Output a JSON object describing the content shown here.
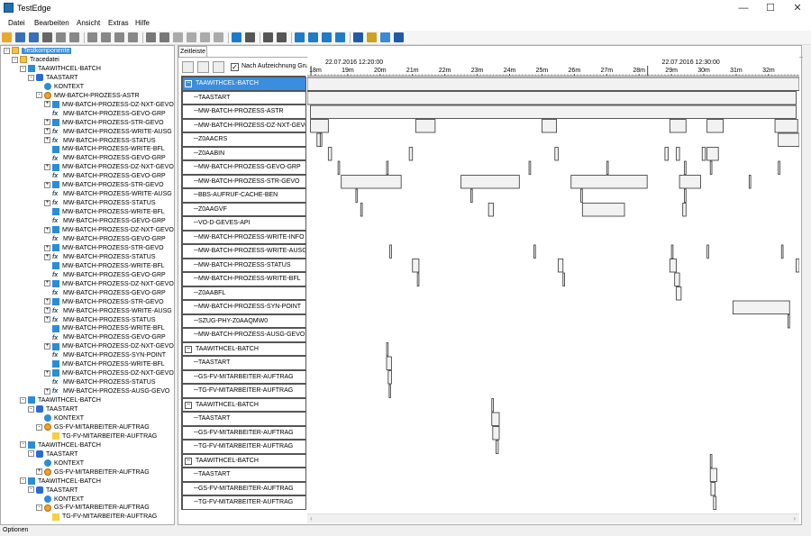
{
  "window": {
    "title": "TestEdge",
    "minimize": "—",
    "maximize": "☐",
    "close": "✕"
  },
  "menu": [
    "Datei",
    "Bearbeiten",
    "Ansicht",
    "Extras",
    "Hilfe"
  ],
  "toolbar_icons": [
    "open-icon",
    "save-icon",
    "save-all-icon",
    "print-icon",
    "copy-icon",
    "import-icon",
    "run-icon",
    "run-all-icon",
    "stop-icon",
    "export-icon",
    "undo-icon",
    "redo-icon",
    "cut-icon",
    "copy2-icon",
    "paste-icon",
    "link-icon",
    "tree-icon",
    "car-icon",
    "back-icon",
    "forward-icon",
    "layout1-icon",
    "layout2-icon",
    "layout3-icon",
    "layout4-icon",
    "help-icon",
    "pin-icon",
    "mail-icon",
    "info-icon"
  ],
  "tree": [
    {
      "label": "Testkomponente",
      "icon": "folder",
      "depth": 0,
      "exp": "-",
      "selected": true
    },
    {
      "label": "Tracedatei",
      "icon": "folder",
      "depth": 1,
      "exp": "-"
    },
    {
      "label": "TAAWITHCEL-BATCH",
      "icon": "doc",
      "depth": 2,
      "exp": "-"
    },
    {
      "label": "TAASTART",
      "icon": "start",
      "depth": 3,
      "exp": "-"
    },
    {
      "label": "KONTEXT",
      "icon": "globe",
      "depth": 4
    },
    {
      "label": "MW-BATCH-PROZESS-ASTR",
      "icon": "gear",
      "depth": 4,
      "exp": "-"
    },
    {
      "label": "MW-BATCH-PROZESS-DZ-NXT-GEVO",
      "icon": "doc",
      "depth": 5,
      "exp": "+"
    },
    {
      "label": "MW-BATCH-PROZESS-GEVO-GRP",
      "icon": "fx",
      "depth": 5
    },
    {
      "label": "MW-BATCH-PROZESS-STR-GEVO",
      "icon": "doc",
      "depth": 5,
      "exp": "+"
    },
    {
      "label": "MW-BATCH-PROZESS-WRITE-AUSG",
      "icon": "fx",
      "depth": 5,
      "exp": "+"
    },
    {
      "label": "MW-BATCH-PROZESS-STATUS",
      "icon": "fx",
      "depth": 5,
      "exp": "+"
    },
    {
      "label": "MW-BATCH-PROZESS-WRITE-BFL",
      "icon": "doc",
      "depth": 5
    },
    {
      "label": "MW-BATCH-PROZESS-GEVO-GRP",
      "icon": "fx",
      "depth": 5
    },
    {
      "label": "MW-BATCH-PROZESS-DZ-NXT-GEVO",
      "icon": "doc",
      "depth": 5,
      "exp": "+"
    },
    {
      "label": "MW-BATCH-PROZESS-GEVO-GRP",
      "icon": "fx",
      "depth": 5
    },
    {
      "label": "MW-BATCH-PROZESS-STR-GEVO",
      "icon": "doc",
      "depth": 5,
      "exp": "+"
    },
    {
      "label": "MW-BATCH-PROZESS-WRITE-AUSG",
      "icon": "fx",
      "depth": 5
    },
    {
      "label": "MW-BATCH-PROZESS-STATUS",
      "icon": "fx",
      "depth": 5,
      "exp": "+"
    },
    {
      "label": "MW-BATCH-PROZESS-WRITE-BFL",
      "icon": "doc",
      "depth": 5
    },
    {
      "label": "MW-BATCH-PROZESS-GEVO-GRP",
      "icon": "fx",
      "depth": 5
    },
    {
      "label": "MW-BATCH-PROZESS-DZ-NXT-GEVO",
      "icon": "doc",
      "depth": 5,
      "exp": "+"
    },
    {
      "label": "MW-BATCH-PROZESS-GEVO-GRP",
      "icon": "fx",
      "depth": 5
    },
    {
      "label": "MW-BATCH-PROZESS-STR-GEVO",
      "icon": "doc",
      "depth": 5,
      "exp": "+"
    },
    {
      "label": "MW-BATCH-PROZESS-STATUS",
      "icon": "fx",
      "depth": 5,
      "exp": "+"
    },
    {
      "label": "MW-BATCH-PROZESS-WRITE-BFL",
      "icon": "doc",
      "depth": 5
    },
    {
      "label": "MW-BATCH-PROZESS-GEVO-GRP",
      "icon": "fx",
      "depth": 5
    },
    {
      "label": "MW-BATCH-PROZESS-DZ-NXT-GEVO",
      "icon": "doc",
      "depth": 5,
      "exp": "+"
    },
    {
      "label": "MW-BATCH-PROZESS-GEVO-GRP",
      "icon": "fx",
      "depth": 5
    },
    {
      "label": "MW-BATCH-PROZESS-STR-GEVO",
      "icon": "doc",
      "depth": 5,
      "exp": "+"
    },
    {
      "label": "MW-BATCH-PROZESS-WRITE-AUSG",
      "icon": "fx",
      "depth": 5,
      "exp": "+"
    },
    {
      "label": "MW-BATCH-PROZESS-STATUS",
      "icon": "fx",
      "depth": 5,
      "exp": "+"
    },
    {
      "label": "MW-BATCH-PROZESS-WRITE-BFL",
      "icon": "doc",
      "depth": 5
    },
    {
      "label": "MW-BATCH-PROZESS-GEVO-GRP",
      "icon": "fx",
      "depth": 5
    },
    {
      "label": "MW-BATCH-PROZESS-DZ-NXT-GEVO",
      "icon": "doc",
      "depth": 5,
      "exp": "+"
    },
    {
      "label": "MW-BATCH-PROZESS-SYN-POINT",
      "icon": "fx",
      "depth": 5
    },
    {
      "label": "MW-BATCH-PROZESS-WRITE-BFL",
      "icon": "doc",
      "depth": 5
    },
    {
      "label": "MW-BATCH-PROZESS-DZ-NXT-GEVO",
      "icon": "doc",
      "depth": 5,
      "exp": "+"
    },
    {
      "label": "MW-BATCH-PROZESS-STATUS",
      "icon": "fx",
      "depth": 5
    },
    {
      "label": "MW-BATCH-PROZESS-AUSG-GEVO",
      "icon": "fx",
      "depth": 5,
      "exp": "+"
    },
    {
      "label": "TAAWITHCEL-BATCH",
      "icon": "doc",
      "depth": 2,
      "exp": "-"
    },
    {
      "label": "TAASTART",
      "icon": "start",
      "depth": 3,
      "exp": "-"
    },
    {
      "label": "KONTEXT",
      "icon": "globe",
      "depth": 4
    },
    {
      "label": "GS-FV-MITARBEITER-AUFTRAG",
      "icon": "gear",
      "depth": 4,
      "exp": "-"
    },
    {
      "label": "TG-FV-MITARBEITER-AUFTRAG",
      "icon": "key",
      "depth": 5
    },
    {
      "label": "TAAWITHCEL-BATCH",
      "icon": "doc",
      "depth": 2,
      "exp": "-"
    },
    {
      "label": "TAASTART",
      "icon": "start",
      "depth": 3,
      "exp": "-"
    },
    {
      "label": "KONTEXT",
      "icon": "globe",
      "depth": 4
    },
    {
      "label": "GS-FV-MITARBEITER-AUFTRAG",
      "icon": "gear",
      "depth": 4,
      "exp": "+"
    },
    {
      "label": "TAAWITHCEL-BATCH",
      "icon": "doc",
      "depth": 2,
      "exp": "-"
    },
    {
      "label": "TAASTART",
      "icon": "start",
      "depth": 3,
      "exp": "-"
    },
    {
      "label": "KONTEXT",
      "icon": "globe",
      "depth": 4
    },
    {
      "label": "GS-FV-MITARBEITER-AUFTRAG",
      "icon": "gear",
      "depth": 4,
      "exp": "-"
    },
    {
      "label": "TG-FV-MITARBEITER-AUFTRAG",
      "icon": "key",
      "depth": 5
    }
  ],
  "tab": {
    "label": "Zeitleiste"
  },
  "options": {
    "checkbox_label": "Nach Aufzeichnung Gru",
    "checked": "✓"
  },
  "timeline": {
    "date_labels": [
      {
        "text": "22.07.2016 12:20:00",
        "min": 19.2
      },
      {
        "text": "22.07.2016 12:30:00",
        "min": 29.6
      }
    ],
    "ticks": [
      "18m",
      "19m",
      "20m",
      "21m",
      "22m",
      "23m",
      "24m",
      "25m",
      "26m",
      "27m",
      "28m",
      "29m",
      "30m",
      "31m",
      "32m"
    ],
    "axis_range_min": [
      17.75,
      32.95
    ]
  },
  "lanes": [
    {
      "label": "TAAWITHCEL-BATCH",
      "group": true,
      "selected": true,
      "bars": [
        [
          17.75,
          32.95
        ]
      ]
    },
    {
      "label": "TAASTART",
      "bars": [
        [
          17.75,
          32.85
        ]
      ]
    },
    {
      "label": "MW-BATCH-PROZESS-ASTR",
      "bars": [
        [
          17.85,
          32.85
        ]
      ]
    },
    {
      "label": "MW-BATCH-PROZESS-DZ-NXT-GEVO",
      "bars": [
        [
          17.85,
          18.4
        ],
        [
          21.1,
          21.7
        ],
        [
          25.0,
          25.45
        ],
        [
          28.95,
          29.45
        ],
        [
          30.1,
          30.6
        ],
        [
          32.2,
          32.9
        ]
      ]
    },
    {
      "label": "Z0AACRS",
      "bars": [
        [
          18.05,
          18.15
        ],
        [
          18.15,
          18.2
        ],
        [
          32.3,
          32.95
        ]
      ]
    },
    {
      "label": "Z0AABIN",
      "bars": [
        [
          18.4,
          18.5
        ],
        [
          20.9,
          21.0
        ],
        [
          25.4,
          25.5
        ],
        [
          28.8,
          28.9
        ],
        [
          29.15,
          29.25
        ],
        [
          29.95,
          30.05
        ],
        [
          30.1,
          30.45
        ]
      ]
    },
    {
      "label": "MW-BATCH-PROZESS-GEVO-GRP",
      "bars": [
        [
          18.7,
          18.75
        ],
        [
          20.2,
          20.25
        ],
        [
          24.6,
          24.65
        ],
        [
          27.0,
          27.05
        ],
        [
          29.4,
          29.45
        ],
        [
          30.2,
          30.25
        ],
        [
          32.3,
          32.35
        ]
      ]
    },
    {
      "label": "MW-BATCH-PROZESS-STR-GEVO",
      "bars": [
        [
          18.8,
          20.65
        ],
        [
          22.5,
          24.3
        ],
        [
          25.9,
          28.25
        ],
        [
          29.25,
          29.9
        ],
        [
          31.4,
          31.45
        ]
      ]
    },
    {
      "label": "BBS-AUFRUF-CACHE-BEN",
      "bars": [
        [
          19.25,
          19.3
        ],
        [
          22.8,
          22.85
        ],
        [
          26.2,
          26.25
        ],
        [
          29.4,
          29.45
        ]
      ]
    },
    {
      "label": "Z0AAGVF",
      "bars": [
        [
          19.4,
          19.45
        ],
        [
          23.35,
          23.5
        ],
        [
          26.25,
          27.55
        ],
        [
          29.35,
          29.45
        ]
      ]
    },
    {
      "label": "VO-D-GEVES-API",
      "bars": []
    },
    {
      "label": "MW-BATCH-PROZESS-WRITE-INFO",
      "bars": []
    },
    {
      "label": "MW-BATCH-PROZESS-WRITE-AUSG",
      "bars": [
        [
          20.3,
          20.35
        ],
        [
          24.75,
          24.8
        ],
        [
          29.0,
          29.05
        ],
        [
          30.1,
          30.15
        ],
        [
          32.4,
          32.45
        ]
      ]
    },
    {
      "label": "MW-BATCH-PROZESS-STATUS",
      "bars": [
        [
          21.0,
          21.2
        ],
        [
          25.5,
          25.65
        ],
        [
          28.95,
          29.15
        ],
        [
          32.85,
          32.95
        ]
      ]
    },
    {
      "label": "MW-BATCH-PROZESS-WRITE-BFL",
      "bars": [
        [
          21.15,
          21.2
        ],
        [
          25.65,
          25.7
        ],
        [
          29.1,
          29.25
        ]
      ]
    },
    {
      "label": "Z0AABFL",
      "bars": [
        [
          29.15,
          29.3
        ]
      ]
    },
    {
      "label": "MW-BATCH-PROZESS-SYN-POINT",
      "bars": [
        [
          30.9,
          32.65
        ]
      ]
    },
    {
      "label": "SZUG-PHY-Z0AAQMW0",
      "bars": [
        [
          32.6,
          32.65
        ]
      ]
    },
    {
      "label": "MW-BATCH-PROZESS-AUSG-GEVO",
      "bars": []
    },
    {
      "label": "TAAWITHCEL-BATCH",
      "group": true,
      "bars": [
        [
          20.2,
          20.25
        ]
      ]
    },
    {
      "label": "TAASTART",
      "bars": [
        [
          20.2,
          20.35
        ]
      ]
    },
    {
      "label": "GS-FV-MITARBEITER-AUFTRAG",
      "bars": [
        [
          20.25,
          20.35
        ]
      ]
    },
    {
      "label": "TG-FV-MITARBEITER-AUFTRAG",
      "bars": [
        [
          20.28,
          20.32
        ]
      ]
    },
    {
      "label": "TAAWITHCEL-BATCH",
      "group": true,
      "bars": [
        [
          23.45,
          23.5
        ]
      ]
    },
    {
      "label": "TAASTART",
      "bars": [
        [
          23.45,
          23.68
        ]
      ]
    },
    {
      "label": "GS-FV-MITARBEITER-AUFTRAG",
      "bars": [
        [
          23.48,
          23.68
        ]
      ]
    },
    {
      "label": "TG-FV-MITARBEITER-AUFTRAG",
      "bars": [
        [
          23.58,
          23.65
        ]
      ]
    },
    {
      "label": "TAAWITHCEL-BATCH",
      "group": true,
      "bars": [
        [
          30.2,
          30.25
        ]
      ]
    },
    {
      "label": "TAASTART",
      "bars": [
        [
          30.2,
          30.4
        ]
      ]
    },
    {
      "label": "GS-FV-MITARBEITER-AUFTRAG",
      "bars": [
        [
          30.22,
          30.35
        ]
      ]
    },
    {
      "label": "TG-FV-MITARBEITER-AUFTRAG",
      "bars": [
        [
          30.3,
          30.38
        ]
      ]
    }
  ],
  "hscroll": {
    "left": "‹",
    "right": "›"
  },
  "status": "Optionen"
}
